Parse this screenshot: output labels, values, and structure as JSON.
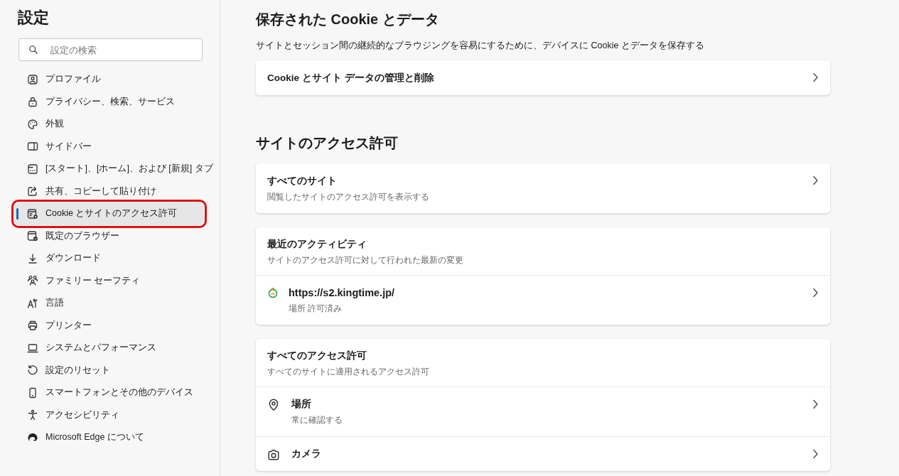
{
  "sidebar": {
    "title": "設定",
    "search": {
      "placeholder": "設定の検索"
    },
    "items": [
      {
        "label": "プロファイル",
        "selected": false
      },
      {
        "label": "プライバシー、検索、サービス",
        "selected": false
      },
      {
        "label": "外観",
        "selected": false
      },
      {
        "label": "サイドバー",
        "selected": false
      },
      {
        "label": "[スタート]、[ホーム]、および [新規] タブ",
        "selected": false
      },
      {
        "label": "共有、コピーして貼り付け",
        "selected": false
      },
      {
        "label": "Cookie とサイトのアクセス許可",
        "selected": true
      },
      {
        "label": "既定のブラウザー",
        "selected": false
      },
      {
        "label": "ダウンロード",
        "selected": false
      },
      {
        "label": "ファミリー セーフティ",
        "selected": false
      },
      {
        "label": "言語",
        "selected": false
      },
      {
        "label": "プリンター",
        "selected": false
      },
      {
        "label": "システムとパフォーマンス",
        "selected": false
      },
      {
        "label": "設定のリセット",
        "selected": false
      },
      {
        "label": "スマートフォンとその他のデバイス",
        "selected": false
      },
      {
        "label": "アクセシビリティ",
        "selected": false
      },
      {
        "label": "Microsoft Edge について",
        "selected": false
      }
    ]
  },
  "sections": [
    {
      "heading": "保存された Cookie とデータ",
      "description": "サイトとセッション間の継続的なブラウジングを容易にするために、デバイスに Cookie とデータを保存する",
      "cards": [
        {
          "rows": [
            {
              "kind": "link",
              "title": "Cookie とサイト データの管理と削除"
            }
          ]
        }
      ]
    },
    {
      "heading": "サイトのアクセス許可",
      "cards": [
        {
          "rows": [
            {
              "kind": "link",
              "title": "すべてのサイト",
              "subtitle": "閲覧したサイトのアクセス許可を表示する"
            }
          ]
        },
        {
          "rows": [
            {
              "kind": "header",
              "title": "最近のアクティビティ",
              "subtitle": "サイトのアクセス許可に対して行われた最新の変更"
            },
            {
              "kind": "site",
              "title": "https://s2.kingtime.jp/",
              "subtitle": "場所 許可済み"
            }
          ]
        },
        {
          "rows": [
            {
              "kind": "header",
              "title": "すべてのアクセス許可",
              "subtitle": "すべてのサイトに適用されるアクセス許可"
            },
            {
              "kind": "permission",
              "title": "場所",
              "subtitle": "常に確認する"
            },
            {
              "kind": "permission",
              "title": "カメラ"
            }
          ]
        }
      ]
    }
  ]
}
